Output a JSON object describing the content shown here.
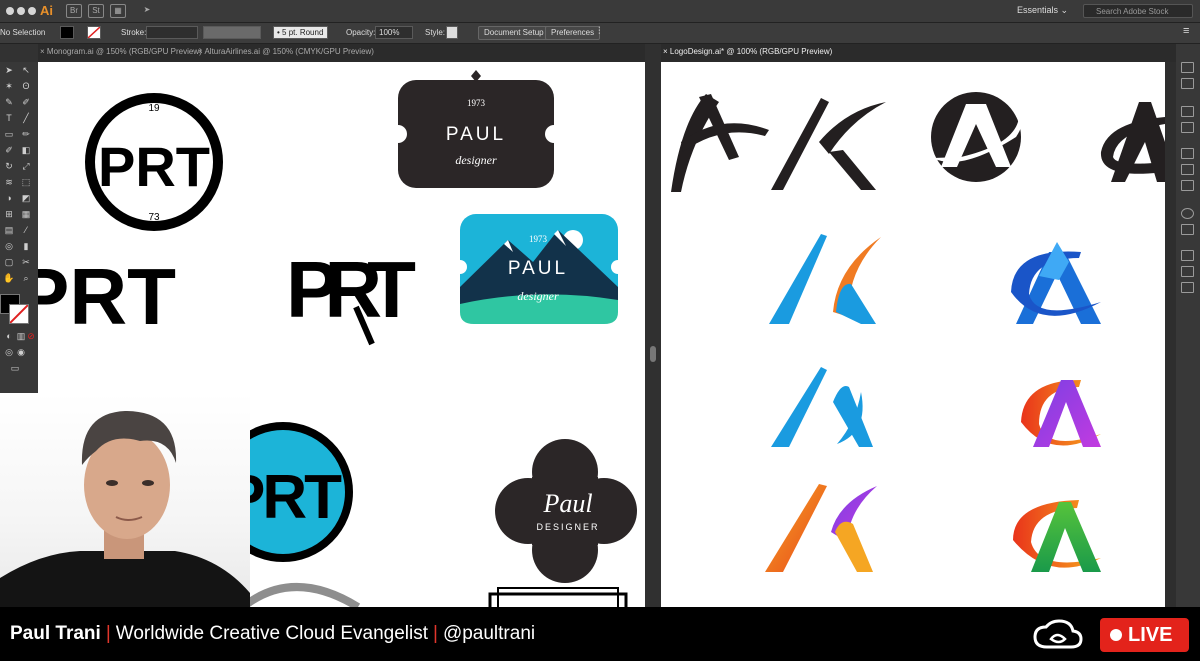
{
  "app": {
    "logo": "Ai",
    "btn_br": "Br",
    "btn_st": "St",
    "workspace": "Essentials",
    "search_placeholder": "Search Adobe Stock"
  },
  "control_bar": {
    "selection": "No Selection",
    "stroke_label": "Stroke:",
    "brush": "5 pt. Round",
    "opacity_label": "Opacity:",
    "opacity_value": "100%",
    "style_label": "Style:",
    "document_setup": "Document Setup",
    "preferences": "Preferences"
  },
  "tabs_left": [
    {
      "label": "Monogram.ai @ 150% (RGB/GPU Preview)"
    },
    {
      "label": "AlturaAirlines.ai @ 150% (CMYK/GPU Preview)"
    }
  ],
  "tabs_right": [
    {
      "label": "LogoDesign.ai* @ 100% (RGB/GPU Preview)"
    }
  ],
  "artwork": {
    "prt": "PRT",
    "year_top": "19",
    "year_bottom": "73",
    "badge_year": "1973",
    "paul": "PAUL",
    "designer": "designer",
    "script_paul": "Paul",
    "designer_caps": "DESIGNER"
  },
  "colors": {
    "accent_cyan": "#1cb4d8",
    "badge_dark": "#2b2627",
    "live_red": "#e3231b",
    "divider_red": "#e0362c"
  },
  "overlay": {
    "presenter": "Paul Trani",
    "title": "Worldwide Creative Cloud Evangelist",
    "handle": "@paultrani",
    "live": "LIVE"
  }
}
